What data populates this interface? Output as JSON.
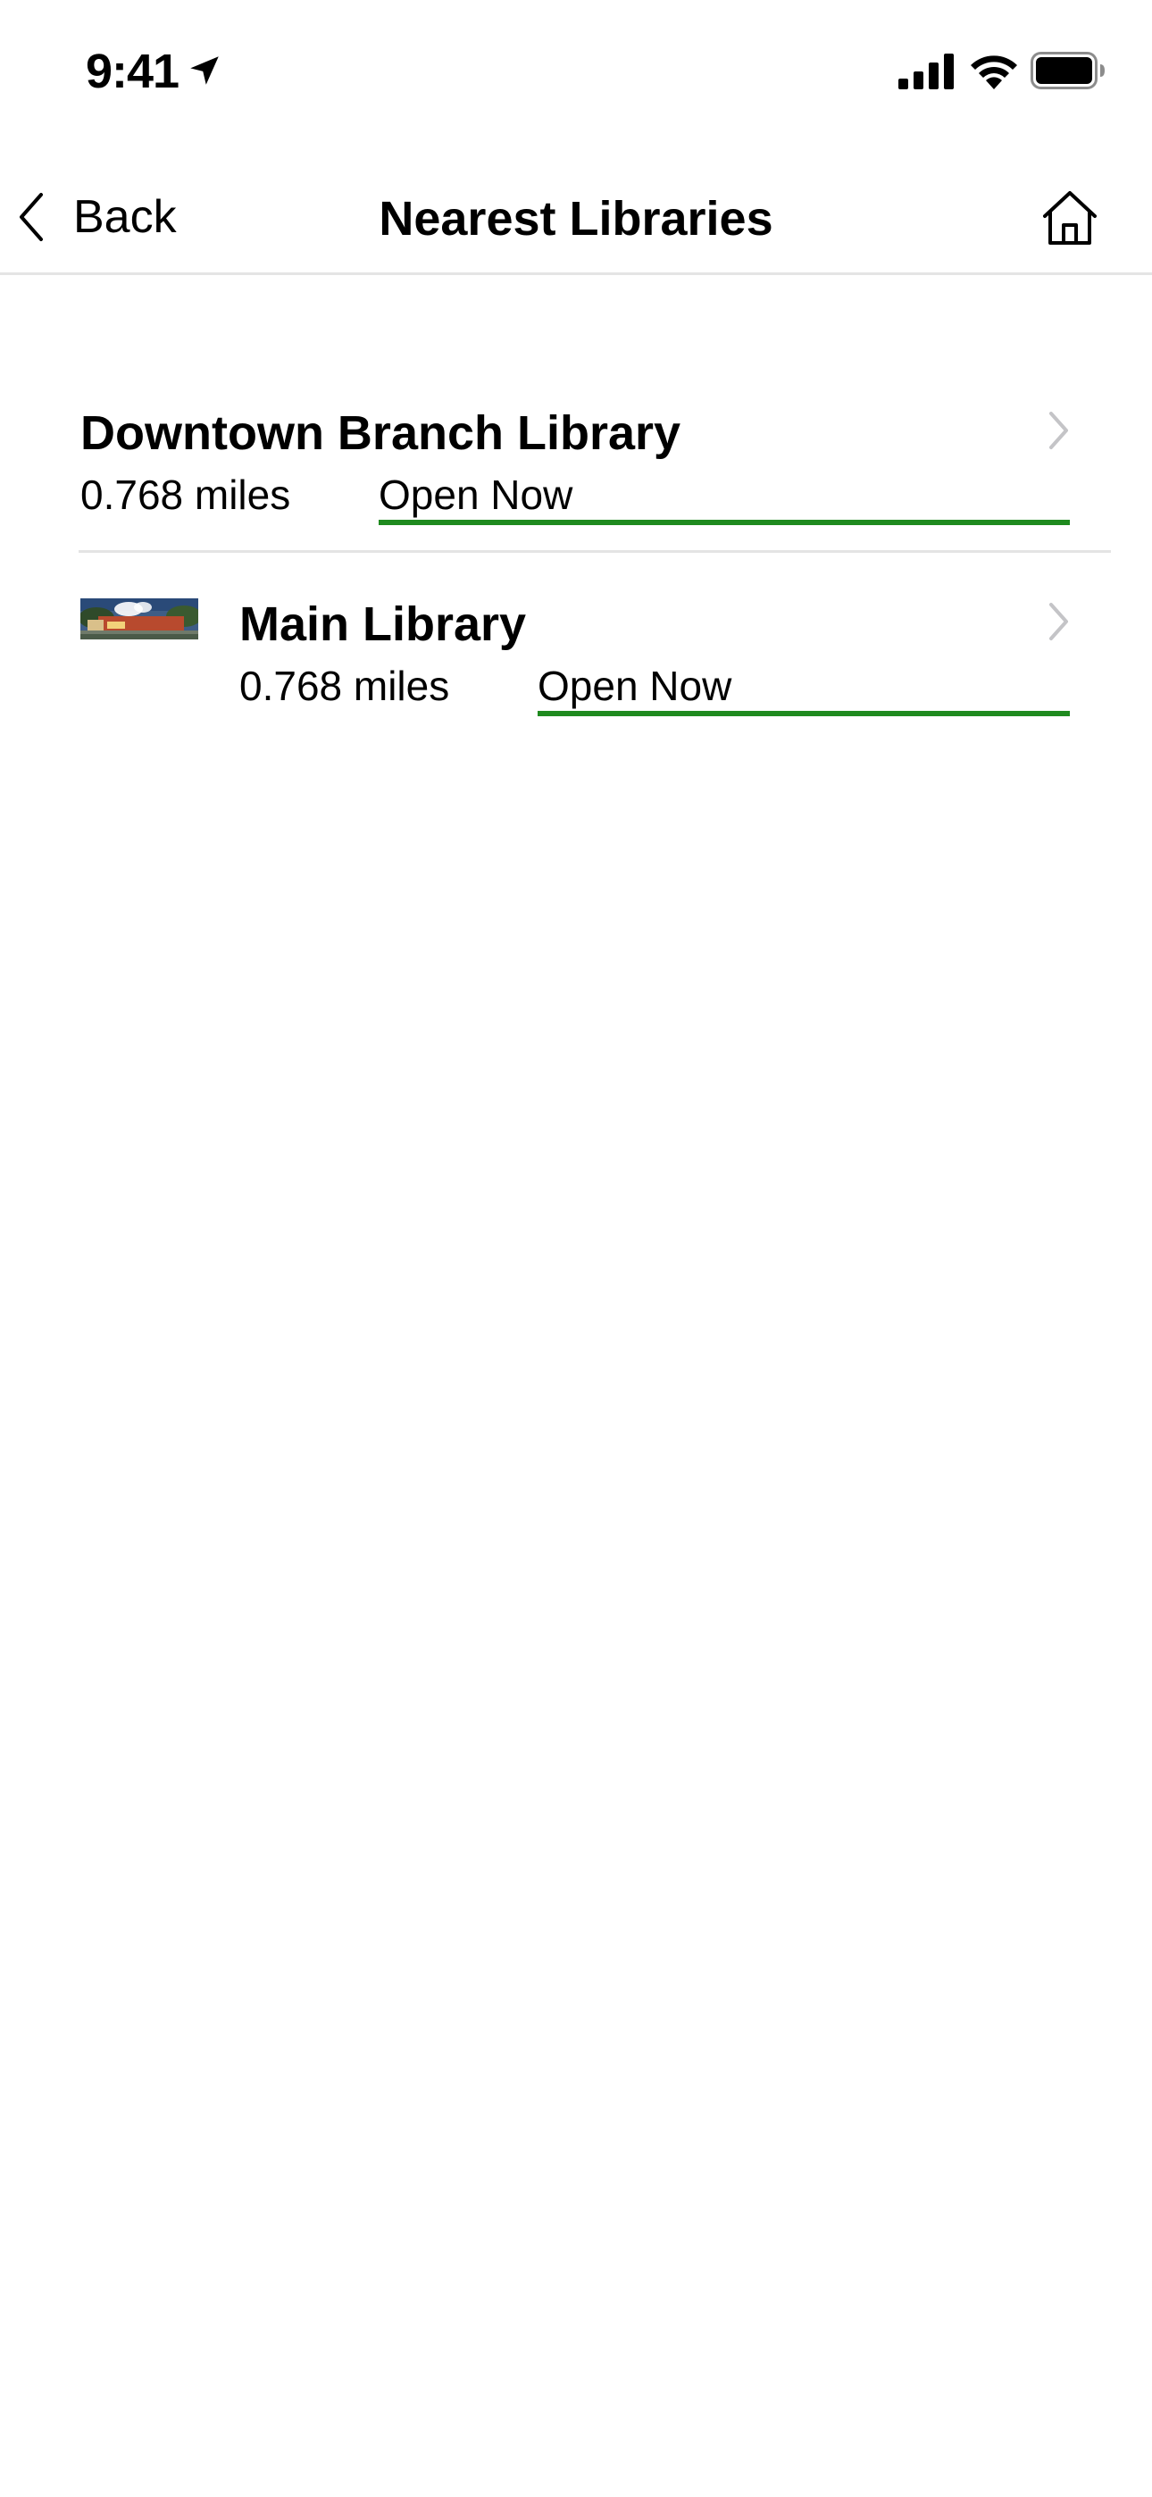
{
  "status_bar": {
    "time": "9:41",
    "icons": [
      "location-arrow-icon",
      "cellular-signal-icon",
      "wifi-icon",
      "battery-icon"
    ]
  },
  "nav": {
    "back_label": "Back",
    "title": "Nearest Libraries",
    "back_icon": "chevron-left-icon",
    "home_icon": "home-icon"
  },
  "libraries": [
    {
      "name": "Downtown Branch Library",
      "distance": "0.768 miles",
      "status": "Open Now",
      "has_thumbnail": false
    },
    {
      "name": "Main Library",
      "distance": "0.768 miles",
      "status": "Open Now",
      "has_thumbnail": true
    }
  ],
  "colors": {
    "open_status": "#1f8a1f",
    "divider": "#e4e4e4",
    "chevron": "#c4c4c7"
  }
}
